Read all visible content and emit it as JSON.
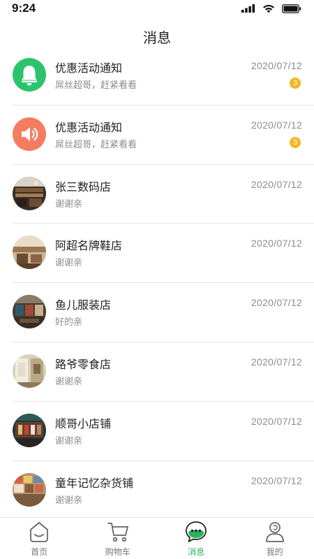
{
  "status_bar": {
    "time": "9:24"
  },
  "header": {
    "title": "消息"
  },
  "messages": [
    {
      "name": "优惠活动通知",
      "preview": "屌丝超哥，赶紧看看",
      "date": "2020/07/12",
      "badge": "3",
      "avatar_icon": "bell-icon",
      "avatar_color": "#2cc36b"
    },
    {
      "name": "优惠活动通知",
      "preview": "屌丝超哥，赶紧看看",
      "date": "2020/07/12",
      "badge": "3",
      "avatar_icon": "speaker-icon",
      "avatar_color": "#f47c61"
    },
    {
      "name": "张三数码店",
      "preview": "谢谢亲",
      "date": "2020/07/12",
      "avatar_icon": "store-photo",
      "avatar_color": "#5a4632"
    },
    {
      "name": "阿超名牌鞋店",
      "preview": "谢谢亲",
      "date": "2020/07/12",
      "avatar_icon": "store-photo",
      "avatar_color": "#8a6a48"
    },
    {
      "name": "鱼儿服装店",
      "preview": "好的亲",
      "date": "2020/07/12",
      "avatar_icon": "store-photo",
      "avatar_color": "#4a3a30"
    },
    {
      "name": "路爷零食店",
      "preview": "谢谢亲",
      "date": "2020/07/12",
      "avatar_icon": "store-photo",
      "avatar_color": "#b7a888"
    },
    {
      "name": "顺哥小店铺",
      "preview": "谢谢亲",
      "date": "2020/07/12",
      "avatar_icon": "store-photo",
      "avatar_color": "#2f4a46"
    },
    {
      "name": "童年记忆杂货铺",
      "preview": "谢谢亲",
      "date": "2020/07/12",
      "avatar_icon": "store-photo",
      "avatar_color": "#9a7658"
    }
  ],
  "tabs": [
    {
      "label": "首页",
      "icon": "home-icon",
      "active": false
    },
    {
      "label": "购物车",
      "icon": "cart-icon",
      "active": false
    },
    {
      "label": "消息",
      "icon": "chat-icon",
      "active": true
    },
    {
      "label": "我的",
      "icon": "user-icon",
      "active": false
    }
  ],
  "colors": {
    "accent": "#29b35a",
    "badge": "#f5b623",
    "muted_text": "#8c8c8c"
  }
}
